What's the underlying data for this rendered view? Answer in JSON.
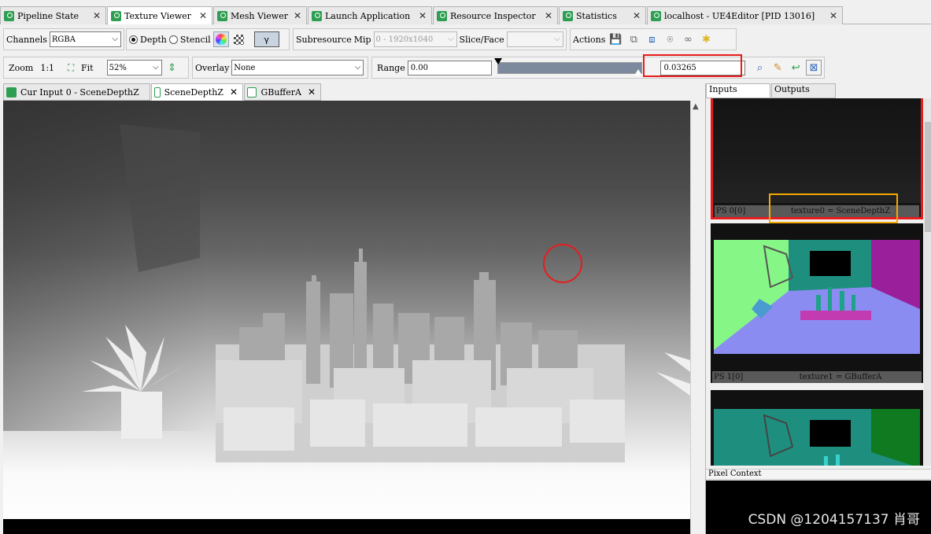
{
  "tabs": [
    {
      "label": "Pipeline State",
      "active": false
    },
    {
      "label": "Texture Viewer",
      "active": true
    },
    {
      "label": "Mesh Viewer",
      "active": false
    },
    {
      "label": "Launch Application",
      "active": false
    },
    {
      "label": "Resource Inspector",
      "active": false
    },
    {
      "label": "Statistics",
      "active": false
    },
    {
      "label": "localhost - UE4Editor [PID 13016]",
      "active": false
    }
  ],
  "toolbar1": {
    "channels_label": "Channels",
    "channels_value": "RGBA",
    "depth_label": "Depth",
    "stencil_label": "Stencil",
    "subresource_label": "Subresource",
    "mip_label": "Mip",
    "mip_value": "0 - 1920x1040",
    "slice_label": "Slice/Face",
    "slice_value": "",
    "actions_label": "Actions"
  },
  "toolbar2": {
    "zoom_label": "Zoom",
    "zoom_ratio": "1:1",
    "fit_label": "Fit",
    "zoom_value": "52%",
    "overlay_label": "Overlay",
    "overlay_value": "None",
    "range_label": "Range",
    "range_min": "0.00",
    "range_max": "0.03265"
  },
  "doc_tabs": [
    {
      "label": "Cur Input 0 - SceneDepthZ",
      "active": false
    },
    {
      "label": "SceneDepthZ",
      "active": true
    },
    {
      "label": "GBufferA",
      "active": false
    }
  ],
  "io_tabs": [
    {
      "label": "Inputs",
      "active": true
    },
    {
      "label": "Outputs",
      "active": false
    }
  ],
  "thumbnails": [
    {
      "slot": "PS 0[0]",
      "name": "texture0 = SceneDepthZ"
    },
    {
      "slot": "PS 1[0]",
      "name": "texture1 = GBufferA"
    },
    {
      "slot": "",
      "name": ""
    }
  ],
  "pixel_context": {
    "title": "Pixel Context"
  },
  "watermark": "CSDN @1204157137 肖哥",
  "colors": {
    "highlight_red": "#e81c1c",
    "highlight_orange": "#f5a800",
    "tab_icon_green": "#2e9e52"
  }
}
